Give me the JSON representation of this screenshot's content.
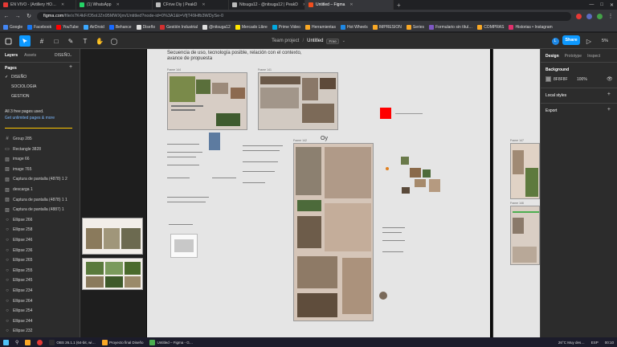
{
  "browser": {
    "tabs": [
      {
        "label": "EN VIVO - (Artillery HO…",
        "color": "#e53935",
        "active": false
      },
      {
        "label": "(1) WhatsApp",
        "color": "#25d366",
        "active": false
      },
      {
        "label": "CFrive Diy | PeakD",
        "color": "#bbbbbb",
        "active": false
      },
      {
        "label": "Nitsuga12 - @nitsuga12 | PeakD",
        "color": "#bbbbbb",
        "active": false
      },
      {
        "label": "Untitled – Figma",
        "color": "#f24e1e",
        "active": true
      }
    ],
    "new_tab": "+",
    "url_host": "figma.com",
    "url_path": "/file/x7K4kF/O5oIJZn95MWXjm/Untitled?node-id=0%3A1&t=VfjT49Hfb3WDySe-0",
    "bookmarks": [
      {
        "label": "Google",
        "color": "#4285f4"
      },
      {
        "label": "Facebook",
        "color": "#1877f2"
      },
      {
        "label": "YouTube",
        "color": "#ff0000"
      },
      {
        "label": "AirDroid",
        "color": "#3ba8ff"
      },
      {
        "label": "Behance",
        "color": "#1769ff"
      },
      {
        "label": "Diseño",
        "color": "#e0e0e0"
      },
      {
        "label": "Gestión Industrial",
        "color": "#d32f2f"
      },
      {
        "label": "@nitsuga12",
        "color": "#e0e0e0"
      },
      {
        "label": "Mercado Libre",
        "color": "#ffe600"
      },
      {
        "label": "Prime Video",
        "color": "#00a8e1"
      },
      {
        "label": "Herramientas",
        "color": "#f9a825"
      },
      {
        "label": "Hot Wheels",
        "color": "#1e88e5"
      },
      {
        "label": "IMPRESION",
        "color": "#f9a825"
      },
      {
        "label": "Series",
        "color": "#f9a825"
      },
      {
        "label": "Formulario sin títul…",
        "color": "#7e57c2"
      },
      {
        "label": "COMPRAS",
        "color": "#f9a825"
      },
      {
        "label": "Historias • Instagram",
        "color": "#e1306c"
      }
    ]
  },
  "figma": {
    "team": "Team project",
    "file": "Untitled",
    "plan_badge": "Free",
    "share": "Share",
    "zoom": "5%",
    "avatar": "L"
  },
  "left_panel": {
    "tabs": [
      "Layers",
      "Assets"
    ],
    "page_selector": "DISEÑO",
    "pages_title": "Pages",
    "pages": [
      "DISEÑO",
      "SOCIOLOGIA",
      "GESTION"
    ],
    "current_page": "DISEÑO",
    "promo_line1": "All 3 free pages used.",
    "promo_line2": "Get unlimited pages & more",
    "layers": [
      {
        "name": "Group 285",
        "icon": "#"
      },
      {
        "name": "Rectangle 3828",
        "icon": "▭"
      },
      {
        "name": "image 66",
        "icon": "▨"
      },
      {
        "name": "image 765",
        "icon": "▨"
      },
      {
        "name": "Captura de pantalla (4878) 1 2",
        "icon": "▨"
      },
      {
        "name": "descarga 1",
        "icon": "▨"
      },
      {
        "name": "Captura de pantalla (4878) 1 1",
        "icon": "▨"
      },
      {
        "name": "Captura de pantalla (4887) 1",
        "icon": "▨"
      },
      {
        "name": "Ellipse 266",
        "icon": "○"
      },
      {
        "name": "Ellipse 258",
        "icon": "○"
      },
      {
        "name": "Ellipse 246",
        "icon": "○"
      },
      {
        "name": "Ellipse 236",
        "icon": "○"
      },
      {
        "name": "Ellipse 265",
        "icon": "○"
      },
      {
        "name": "Ellipse 255",
        "icon": "○"
      },
      {
        "name": "Ellipse 245",
        "icon": "○"
      },
      {
        "name": "Ellipse 234",
        "icon": "○"
      },
      {
        "name": "Ellipse 264",
        "icon": "○"
      },
      {
        "name": "Ellipse 254",
        "icon": "○"
      },
      {
        "name": "Ellipse 244",
        "icon": "○"
      },
      {
        "name": "Ellipse 232",
        "icon": "○"
      }
    ]
  },
  "canvas": {
    "heading_line1": "Secuencia de uso, tecnología posible, relación con el contexto,",
    "heading_line2": "avance de propuesta",
    "frames": [
      "Frame 144",
      "Frame 141",
      "Frame 142",
      "Frame 147",
      "Frame 146"
    ],
    "cursor_label": "Oy"
  },
  "right_panel": {
    "tabs": [
      "Design",
      "Prototype",
      "Inspect"
    ],
    "background_title": "Background",
    "background_hex": "8F8F8F",
    "background_opacity": "100%",
    "background_color": "#8f8f8f",
    "local_styles": "Local styles",
    "export": "Export"
  },
  "taskbar": {
    "items": [
      {
        "label": "OBS 26.1.1 (64-bit, wi…",
        "color": "#302e31"
      },
      {
        "label": "Proyecto final Diseño",
        "color": "#f9a825"
      },
      {
        "label": "Untitled – Figma - G…",
        "color": "#4caf50"
      }
    ],
    "weather": "26°C  Muy des…",
    "lang": "ESP",
    "time": "00:10"
  }
}
